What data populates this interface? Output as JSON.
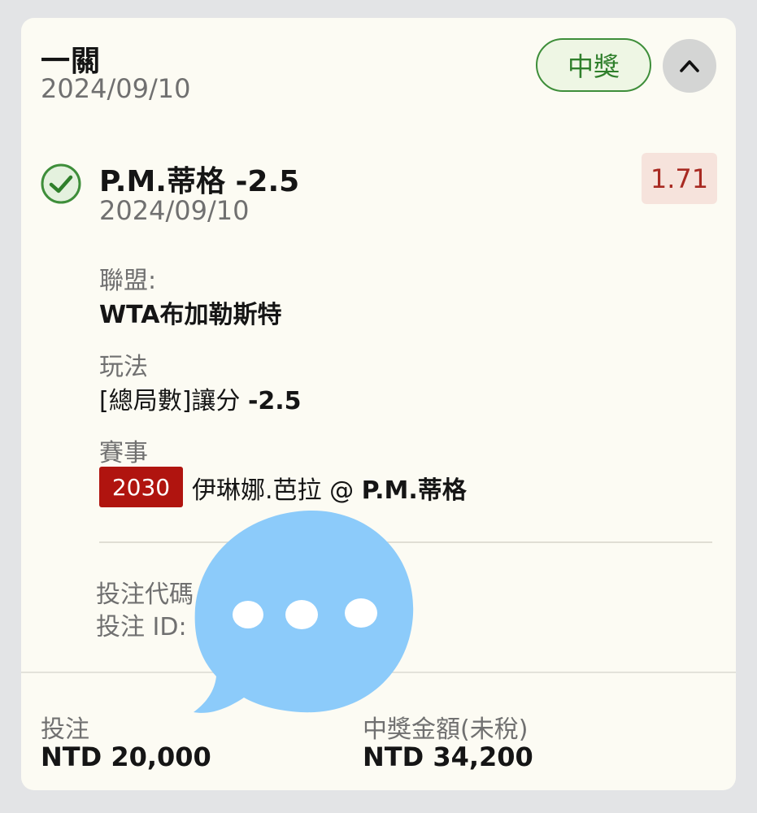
{
  "header": {
    "title": "一關",
    "date": "2024/09/10",
    "status_badge": "中獎",
    "collapse_icon": "chevron-up-icon"
  },
  "selection": {
    "status_icon": "check-circle-icon",
    "name": "P.M.蒂格 -2.5",
    "date": "2024/09/10",
    "odds": "1.71",
    "league_label": "聯盟:",
    "league_value": "WTA布加勒斯特",
    "market_label": "玩法",
    "market_value_prefix": "[總局數]讓分 ",
    "market_value_line": "-2.5",
    "event_label": "賽事",
    "event_id": "2030",
    "event_name_prefix": "伊琳娜.芭拉 @ ",
    "event_name_suffix": "P.M.蒂格"
  },
  "bet_meta": {
    "code_label": "投注代碼",
    "id_label": "投注 ID:"
  },
  "footer": {
    "stake_label": "投注",
    "stake_value": "NTD 20,000",
    "payout_label": "中獎金額(未稅)",
    "payout_value": "NTD 34,200"
  },
  "overlay": {
    "icon": "chat-bubble-more-icon"
  },
  "colors": {
    "card_bg": "#fcfbf3",
    "win_green": "#3e8e3a",
    "odds_red": "#a82a22",
    "event_badge_red": "#b0140f",
    "overlay_blue": "#8ccbfa"
  }
}
